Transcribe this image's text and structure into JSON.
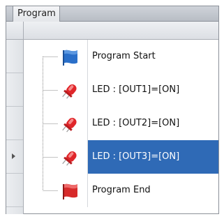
{
  "tab": {
    "label": "Program"
  },
  "rows": [
    {
      "label": "Program Start",
      "icon": "blue-flag-icon"
    },
    {
      "label": "LED : [OUT1]=[ON]",
      "icon": "red-led-icon"
    },
    {
      "label": "LED : [OUT2]=[ON]",
      "icon": "red-led-icon"
    },
    {
      "label": "LED : [OUT3]=[ON]",
      "icon": "red-led-icon",
      "selected": true
    },
    {
      "label": "Program End",
      "icon": "red-flag-icon"
    }
  ],
  "colors": {
    "selection": "#2f6ab6",
    "flag_blue": "#2a6fc9",
    "flag_red": "#d72a2a",
    "led_red": "#e0262a"
  }
}
